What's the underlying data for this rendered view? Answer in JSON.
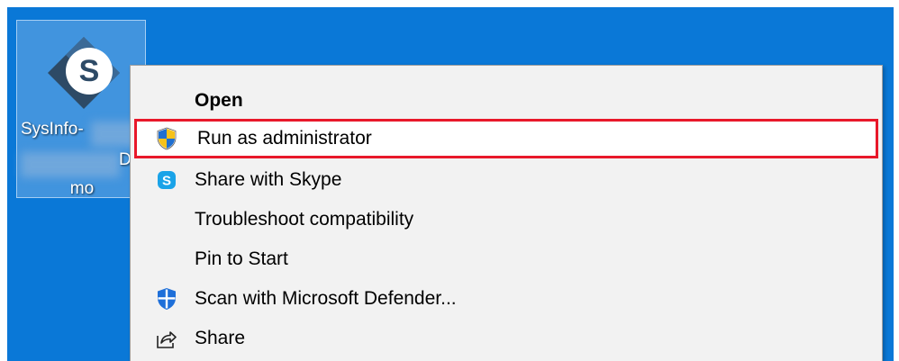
{
  "desktop_icon": {
    "label_line1": "SysInfo-",
    "label_line2": "D",
    "label_line3": "mo",
    "logo_letter": "S",
    "icon": "sysinfo-app-icon"
  },
  "context_menu": {
    "items": [
      {
        "label": "Open",
        "icon": null
      },
      {
        "label": "Run as administrator",
        "icon": "uac-shield-icon"
      },
      {
        "label": "Share with Skype",
        "icon": "skype-icon"
      },
      {
        "label": "Troubleshoot compatibility",
        "icon": null
      },
      {
        "label": "Pin to Start",
        "icon": null
      },
      {
        "label": "Scan with Microsoft Defender...",
        "icon": "defender-icon"
      },
      {
        "label": "Share",
        "icon": "share-icon"
      }
    ]
  },
  "colors": {
    "desktop_bg": "#0a78d7",
    "menu_bg": "#f2f2f2",
    "highlight_border": "#e8182a"
  }
}
